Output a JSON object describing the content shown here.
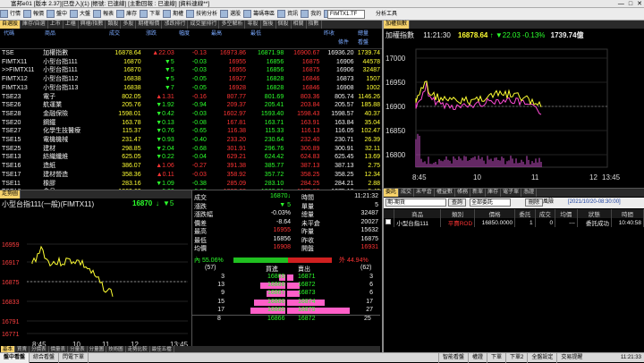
{
  "window": {
    "title": "富邦e01 [版本 2.37][已登入](1) [帳號: 已連線] [主動回報 : 已連線] [資料連線**]"
  },
  "menu": {
    "items": [
      "行情 ",
      "報價 ",
      "盤中 ",
      "大盤 ",
      "報表 ",
      "庫存 ",
      "下單 ",
      "期權 ",
      "技術分析 ",
      "選股 ",
      "籌碼專區 ",
      "資訊 ",
      "我的 ",
      "新聞"
    ],
    "symbol": "FIMTX1.TF",
    "right_label": "分析工具"
  },
  "quote_tabs": [
    "自選股",
    "庫存/自選",
    "上市",
    "上櫃",
    "興櫃/指數",
    "類股",
    "多股",
    "期權報價",
    "漲跌排行",
    "成交量排行",
    "多空解析",
    "零股",
    "盤後",
    "個股",
    "相關",
    "指數"
  ],
  "quote_header": {
    "left_label": "代碼",
    "name_label": "商品",
    "cols": [
      "成交",
      "漲跌",
      "幅度",
      "最高",
      "最低",
      "昨收",
      "總量"
    ],
    "tabs_right": [
      "條件",
      "看盤"
    ]
  },
  "quote_rows": [
    {
      "code": "TSE",
      "name": "加權指數",
      "price": "16878.64",
      "arrow": "↑",
      "chg": "▲22.03",
      "pct": "-0.13",
      "high": "16973.86",
      "low": "16871.98",
      "prev": "16936.20",
      "last": "16900.67",
      "vol": "1739.74",
      "up": true
    },
    {
      "code": "FIMTX11",
      "name": "小型台指111",
      "price": "16870",
      "arrow": "↓",
      "chg": "▼5",
      "pct": "-0.03",
      "high": "16955",
      "low": "16856",
      "prev": "16906",
      "last": "16875",
      "vol": "44578",
      "up": false
    },
    {
      "code": ">>FIMTX11",
      "name": "小型台指111",
      "price": "16870",
      "arrow": "↓",
      "chg": "▼5",
      "pct": "-0.03",
      "high": "16955",
      "low": "16856",
      "prev": "16906",
      "last": "16875",
      "vol": "32487",
      "up": false
    },
    {
      "code": "FIMTX12",
      "name": "小型台指112",
      "price": "16838",
      "arrow": "↑",
      "chg": "▼5",
      "pct": "-0.05",
      "high": "16927",
      "low": "16828",
      "prev": "16873",
      "last": "16846",
      "vol": "1507",
      "up": false
    },
    {
      "code": "FIMTX13",
      "name": "小型台指113",
      "price": "16838",
      "arrow": "↑",
      "chg": "▼7",
      "pct": "-0.05",
      "high": "16928",
      "low": "16828",
      "prev": "16908",
      "last": "16846",
      "vol": "1002",
      "up": false
    },
    {
      "code": "TSE23",
      "name": "電子",
      "price": "802.05",
      "arrow": "↑",
      "chg": "▲1.31",
      "pct": "-0.16",
      "high": "807.77",
      "low": "801.69",
      "prev": "805.74",
      "last": "803.36",
      "vol": "1146.26",
      "up": true
    },
    {
      "code": "TSE26",
      "name": "航運業",
      "price": "205.76",
      "arrow": "↑",
      "chg": "▼1.92",
      "pct": "-0.94",
      "high": "209.37",
      "low": "205.41",
      "prev": "205.57",
      "last": "203.84",
      "vol": "185.88",
      "up": false
    },
    {
      "code": "TSE28",
      "name": "金融保險",
      "price": "1598.01",
      "arrow": "↑",
      "chg": "▼0.42",
      "pct": "-0.03",
      "high": "1602.97",
      "low": "1593.40",
      "prev": "1598.57",
      "last": "1598.43",
      "vol": "40.37",
      "up": false
    },
    {
      "code": "TSE20",
      "name": "鋼鐵",
      "price": "163.78",
      "arrow": "↓",
      "chg": "▼0.13",
      "pct": "-0.08",
      "high": "167.81",
      "low": "163.71",
      "prev": "163.84",
      "last": "163.91",
      "vol": "35.04",
      "up": false
    },
    {
      "code": "TSE27",
      "name": "化學生技醫療",
      "price": "115.37",
      "arrow": "↑",
      "chg": "▼0.76",
      "pct": "-0.65",
      "high": "116.38",
      "low": "115.33",
      "prev": "116.05",
      "last": "116.13",
      "vol": "102.47",
      "up": false
    },
    {
      "code": "TSE15",
      "name": "電機機械",
      "price": "231.47",
      "arrow": "↑",
      "chg": "▼0.93",
      "pct": "-0.40",
      "high": "233.20",
      "low": "230.64",
      "prev": "230.71",
      "last": "232.40",
      "vol": "26.39",
      "up": false
    },
    {
      "code": "TSE25",
      "name": "建材",
      "price": "298.85",
      "arrow": "↓",
      "chg": "▼2.04",
      "pct": "-0.68",
      "high": "301.91",
      "low": "296.76",
      "prev": "300.91",
      "last": "300.89",
      "vol": "32.11",
      "up": false
    },
    {
      "code": "TSE13",
      "name": "紡織纖維",
      "price": "625.05",
      "arrow": "↓",
      "chg": "▼0.22",
      "pct": "-0.04",
      "high": "629.21",
      "low": "624.42",
      "prev": "625.45",
      "last": "624.83",
      "vol": "13.69",
      "up": false
    },
    {
      "code": "TSE16",
      "name": "造紙",
      "price": "386.07",
      "arrow": "↑",
      "chg": "▲1.06",
      "pct": "-0.27",
      "high": "391.38",
      "low": "385.77",
      "prev": "387.13",
      "last": "387.13",
      "vol": "2.75",
      "up": true
    },
    {
      "code": "TSE17",
      "name": "建材營造",
      "price": "358.36",
      "arrow": "↑",
      "chg": "▲0.11",
      "pct": "-0.03",
      "high": "358.92",
      "low": "357.72",
      "prev": "358.25",
      "last": "358.25",
      "vol": "12.34",
      "up": true
    },
    {
      "code": "TSE11",
      "name": "橡膠",
      "price": "283.16",
      "arrow": "↑",
      "chg": "▼1.09",
      "pct": "-0.38",
      "high": "285.09",
      "low": "283.10",
      "prev": "284.21",
      "last": "284.25",
      "vol": "2.88",
      "up": false
    },
    {
      "code": "TSE12",
      "name": "食品",
      "price": "1869.60",
      "arrow": "↑",
      "chg": "▼6.20",
      "pct": "-0.33",
      "high": "1883.68",
      "low": "1868.81",
      "prev": "1875.13",
      "last": "1875.80",
      "vol": "5.42",
      "up": false
    },
    {
      "code": "TSE22",
      "name": "汽車",
      "price": "327.31",
      "arrow": "↑",
      "chg": "▲0.86",
      "pct": "-0.26",
      "high": "328.14",
      "low": "326.58",
      "prev": "326.58",
      "last": "326.45",
      "vol": "15.21",
      "up": true
    }
  ],
  "index_panel": {
    "tab": "加權指數",
    "title": "加權指數",
    "time": "11:21:30",
    "price": "16878.64",
    "arrow": "↑",
    "chg": "▼22.03",
    "pct": "-0.13%",
    "vol": "1739.74億",
    "yticks": [
      "17000",
      "16950",
      "16900",
      "16850",
      "16800"
    ],
    "xticks": [
      "8:45",
      "10",
      "11",
      "12",
      "13:45"
    ]
  },
  "mini_panel": {
    "tab": "走勢圖",
    "title": "小型台指111(一般)(FIMTX11)",
    "price": "16870",
    "arrow": "↓",
    "chg": "▼5",
    "yticks": [
      "16959",
      "16917",
      "16875",
      "16833",
      "16791",
      "16771"
    ],
    "xticks": [
      "8:45",
      "10",
      "11",
      "12",
      "13:45"
    ],
    "bottom_tabs": [
      "基本",
      "買賣",
      "分價表",
      "價量表",
      "分量表",
      "分量圖",
      "技術圖",
      "走勢比較",
      "最佳五檔"
    ]
  },
  "detail_panel": {
    "left": [
      {
        "label": "成交",
        "value": "16870↓"
      },
      {
        "label": "漲跌",
        "value": "▼ 5"
      },
      {
        "label": "漲跌幅",
        "value": "-0.03%"
      },
      {
        "label": "價差",
        "value": "-8.64"
      },
      {
        "label": "最高",
        "value": "16955"
      },
      {
        "label": "最低",
        "value": "16856"
      },
      {
        "label": "均價",
        "value": "16908"
      }
    ],
    "right": [
      {
        "label": "時間",
        "value": "11:21:32"
      },
      {
        "label": "單量",
        "value": "5"
      },
      {
        "label": "總量",
        "value": "32487"
      },
      {
        "label": "未平倉",
        "value": "20027"
      },
      {
        "label": "昨量",
        "value": "15632"
      },
      {
        "label": "昨收",
        "value": "16875"
      },
      {
        "label": "開盤",
        "value": "16931"
      }
    ],
    "bar": {
      "left": "內 55.06%",
      "right": "外 44.94%",
      "inner_fraction": 0.5506
    },
    "book_header": {
      "left_total": "(57)",
      "buy": "買進",
      "sell": "賣出",
      "right_total": "(62)"
    },
    "book": [
      {
        "bq": "3",
        "bp": "16869",
        "sp": "16871",
        "sq": "3",
        "bfrac": 0.05,
        "sfrac": 0.05
      },
      {
        "bq": "13",
        "bp": "16868",
        "sp": "16872",
        "sq": "6",
        "bfrac": 0.2,
        "sfrac": 0.1
      },
      {
        "bq": "9",
        "bp": "16867",
        "sp": "16873",
        "sq": "6",
        "bfrac": 0.15,
        "sfrac": 0.1
      },
      {
        "bq": "15",
        "bp": "16866",
        "sp": "16874",
        "sq": "17",
        "bfrac": 0.25,
        "sfrac": 0.3
      },
      {
        "bq": "17",
        "bp": "16865",
        "sp": "16875",
        "sq": "27",
        "bfrac": 0.28,
        "sfrac": 0.5
      }
    ],
    "book_footer": {
      "bq": "8",
      "bp": "16866",
      "sp": "16872",
      "sq": "25"
    }
  },
  "orders_panel": {
    "tabs": [
      "委託",
      "成交",
      "未平倉",
      "權益數",
      "帳務",
      "新單",
      "庫存",
      "電子單",
      "憑證"
    ],
    "account_select": "期-期貨",
    "query_btn": "查詢",
    "type_select": "全部委託",
    "delete_btn": "刪除",
    "alarm_label": "風險",
    "date_label": "[2021/10/20-08:30:00]",
    "headers": [
      "",
      "商品",
      "類別",
      "價格",
      "委託",
      "成交",
      "均價",
      "狀態",
      "時間"
    ],
    "rows": [
      {
        "product": "小型台指111",
        "type": "平賣ROD",
        "price": "16850.0000",
        "qty": "1",
        "filled": "0",
        "avg": "---",
        "status": "委託成功",
        "time": "10:40:58"
      }
    ]
  },
  "statusbar": {
    "left_tabs": [
      "盤中看盤",
      "綜合看盤",
      "閃電下單"
    ],
    "right_items": [
      "智能看盤",
      "權證",
      "下單",
      "下單2",
      "全盤設定",
      "交易提醒"
    ],
    "time": "11:21:33"
  }
}
